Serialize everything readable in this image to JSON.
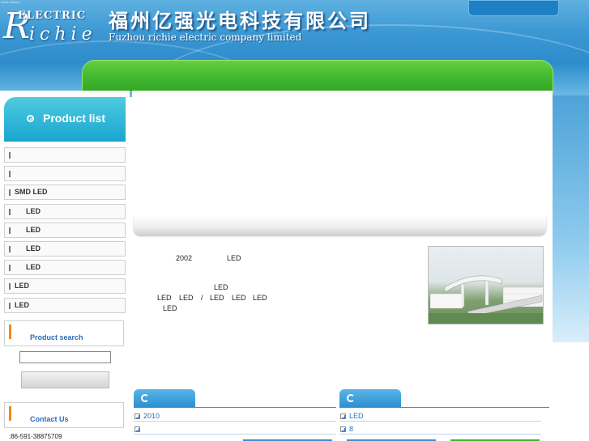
{
  "header": {
    "logo_r": "R",
    "logo_electric": "ELECTRIC",
    "logo_ichie": "ichie",
    "title_cn": "福州亿强光电科技有限公司",
    "title_en": "Fuzhou richie electric company limited"
  },
  "sidebar": {
    "title": "Product list",
    "items": [
      {
        "label": "",
        "indent": false
      },
      {
        "label": "",
        "indent": false
      },
      {
        "label": "SMD LED",
        "indent": false
      },
      {
        "label": "LED",
        "indent": true
      },
      {
        "label": "LED",
        "indent": true
      },
      {
        "label": "LED",
        "indent": true
      },
      {
        "label": "LED",
        "indent": true
      },
      {
        "label": "LED",
        "indent": false
      },
      {
        "label": "LED",
        "indent": false
      }
    ],
    "search_title": "Product search",
    "search_value": "",
    "contact_title": "Contact Us",
    "phone": ":86-591-38875709"
  },
  "about": {
    "year": "2002",
    "led1": "LED",
    "led2": "LED",
    "line3": [
      "LED",
      "LED",
      "/",
      "LED",
      "LED",
      "LED"
    ],
    "led3": "LED"
  },
  "panels": {
    "left_items": [
      "2010",
      ""
    ],
    "right_items": [
      "LED",
      "8"
    ]
  },
  "colors": {
    "header_blue": "#3a97d2",
    "nav_green": "#3fb52e",
    "link_blue": "#2c6db6",
    "accent_orange": "#f08a1a"
  }
}
